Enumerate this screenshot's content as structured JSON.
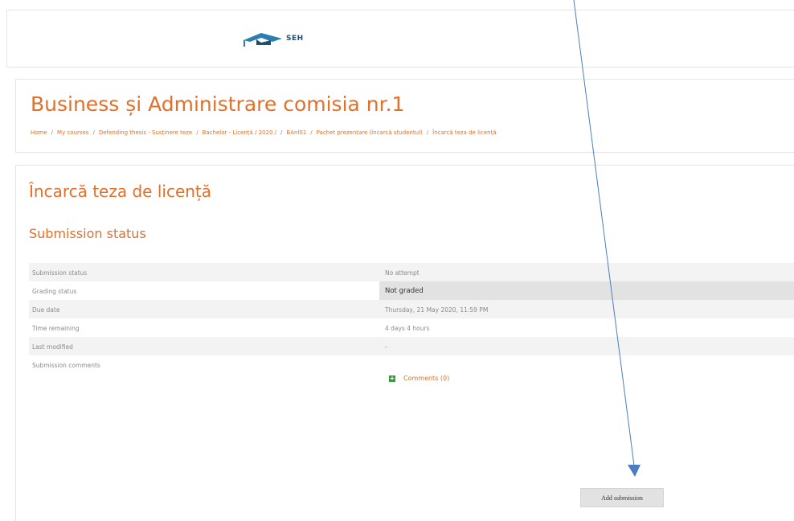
{
  "site": {
    "logo_text": "SEH"
  },
  "course": {
    "title": "Business și Administrare comisia nr.1"
  },
  "breadcrumb": [
    "Home",
    "My courses",
    "Defending thesis - Susținere teze",
    "Bachelor - Licență / 2020 /",
    "BAnl01",
    "Pachet prezentare (încarcă studentul)",
    "Încarcă teza de licență"
  ],
  "page": {
    "title": "Încarcă teza de licență",
    "section_title": "Submission status"
  },
  "status_rows": [
    {
      "label": "Submission status",
      "value": "No attempt"
    },
    {
      "label": "Grading status",
      "value": "Not graded"
    },
    {
      "label": "Due date",
      "value": "Thursday, 21 May 2020, 11:59 PM"
    },
    {
      "label": "Time remaining",
      "value": "4 days 4 hours"
    },
    {
      "label": "Last modified",
      "value": "-"
    },
    {
      "label": "Submission comments",
      "value": ""
    }
  ],
  "comments": {
    "link_text": "Comments (0)"
  },
  "actions": {
    "add_submission": "Add submission"
  },
  "colors": {
    "accent": "#e0702a",
    "arrow": "#4a7ec0",
    "logo": "#1d4f6e"
  }
}
